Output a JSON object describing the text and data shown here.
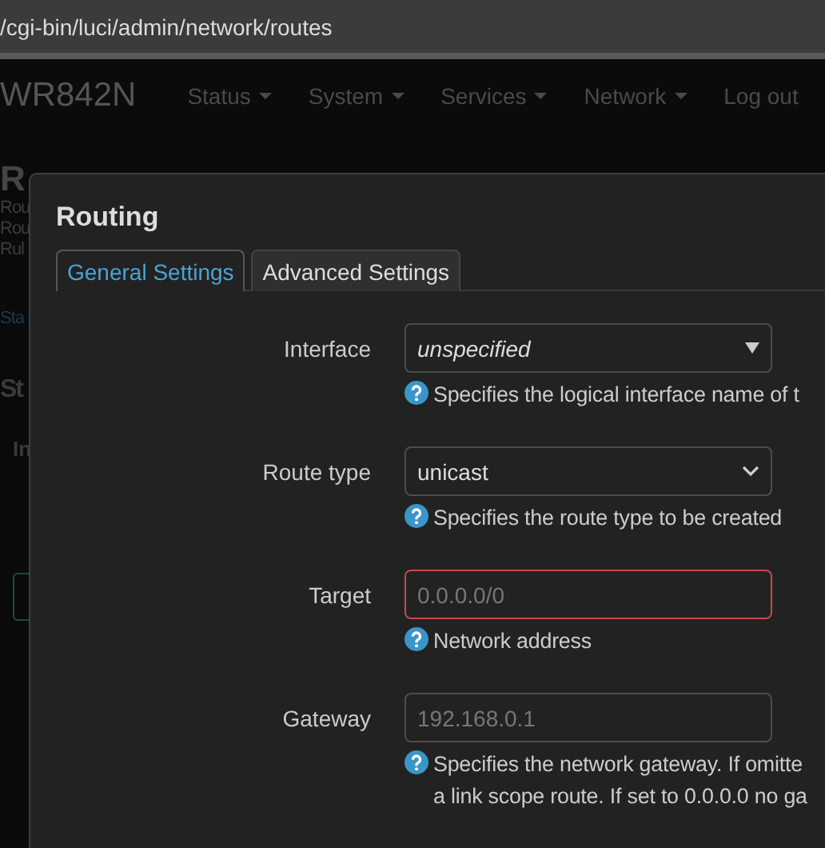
{
  "address_bar": {
    "url": "/cgi-bin/luci/admin/network/routes"
  },
  "navbar": {
    "brand": "WR842N",
    "menu": [
      {
        "label": "Status",
        "dropdown": true
      },
      {
        "label": "System",
        "dropdown": true
      },
      {
        "label": "Services",
        "dropdown": true
      },
      {
        "label": "Network",
        "dropdown": true
      },
      {
        "label": "Log out",
        "dropdown": false
      }
    ]
  },
  "background_page": {
    "heading": "R",
    "lines": [
      "Rou",
      "Rou",
      "Rul"
    ],
    "tab": "Sta",
    "section": "St",
    "column_1": "In"
  },
  "dialog": {
    "title": "Routing",
    "tabs": [
      {
        "label": "General Settings",
        "selected": true
      },
      {
        "label": "Advanced Settings",
        "selected": false
      }
    ],
    "fields": [
      {
        "label": "Interface",
        "kind": "dropdown",
        "value": "unspecified",
        "invalid": false,
        "help": [
          "Specifies the logical interface name of t"
        ]
      },
      {
        "label": "Route type",
        "kind": "select",
        "value": "unicast",
        "invalid": false,
        "help": [
          "Specifies the route type to be created"
        ]
      },
      {
        "label": "Target",
        "kind": "text",
        "placeholder": "0.0.0.0/0",
        "invalid": true,
        "help": [
          "Network address"
        ]
      },
      {
        "label": "Gateway",
        "kind": "text",
        "placeholder": "192.168.0.1",
        "invalid": false,
        "help": [
          "Specifies the network gateway. If omitte",
          "a link scope route. If set to 0.0.0.0 no ga"
        ]
      }
    ]
  }
}
